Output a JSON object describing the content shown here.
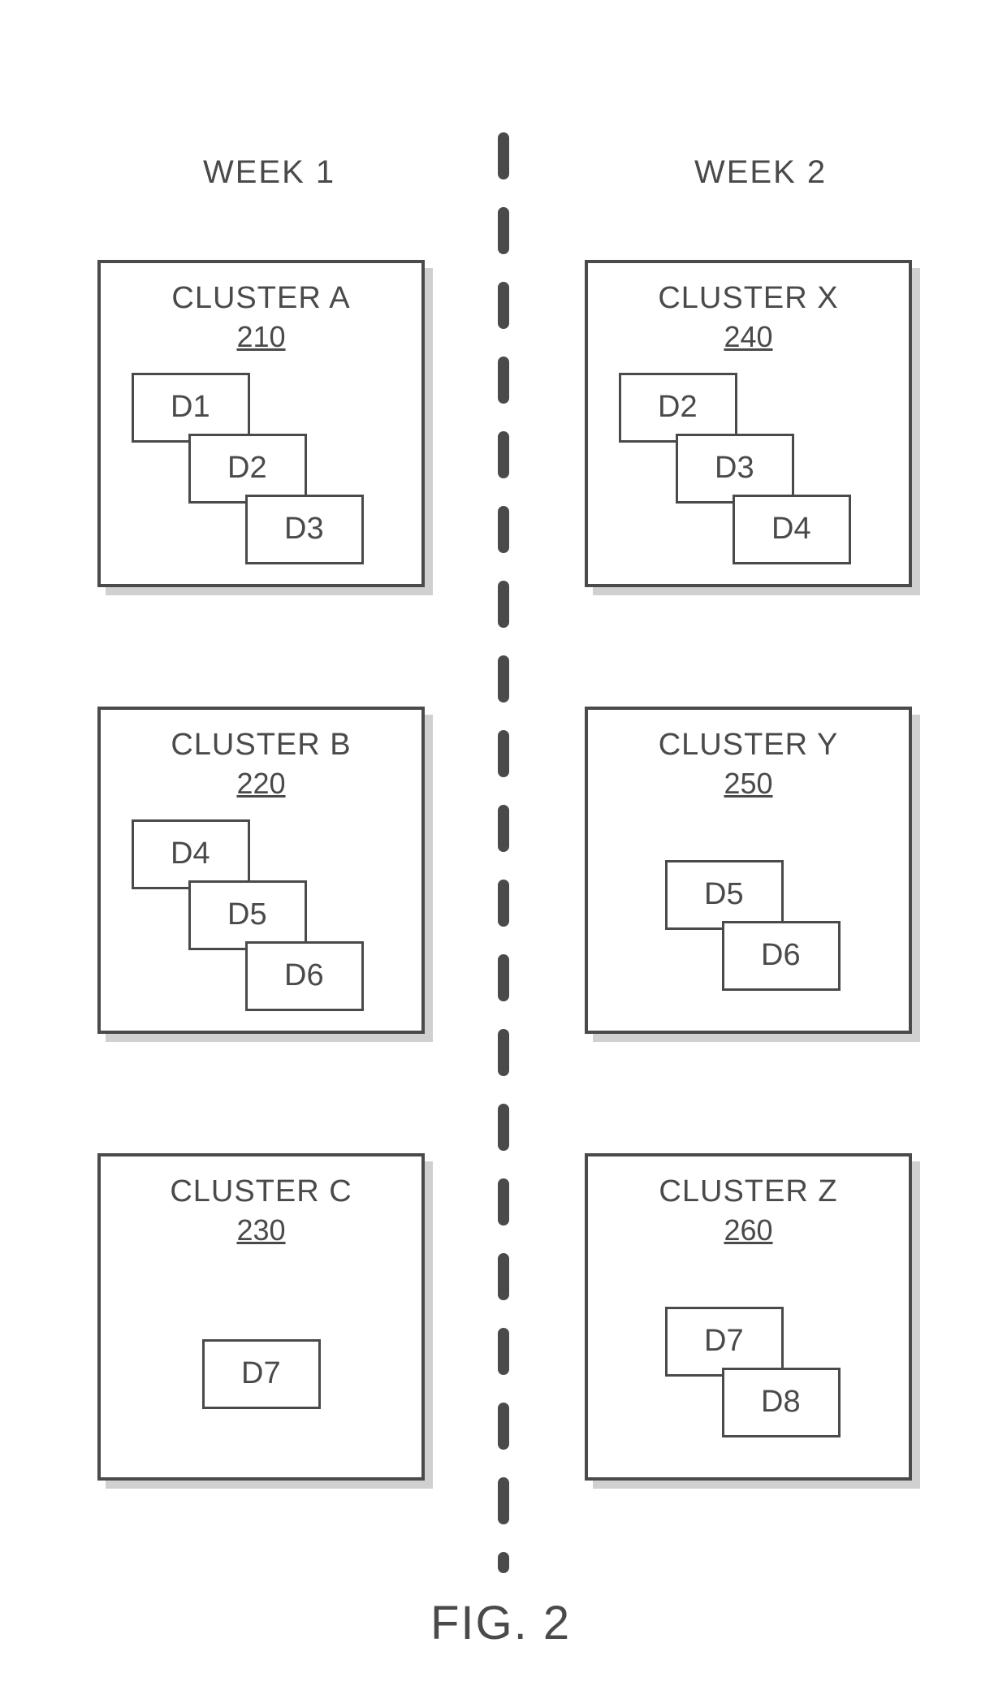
{
  "headers": {
    "left": "WEEK 1",
    "right": "WEEK 2"
  },
  "figure_label": "FIG. 2",
  "clusters": {
    "a": {
      "title": "CLUSTER A",
      "id": "210",
      "docs": [
        "D1",
        "D2",
        "D3"
      ]
    },
    "b": {
      "title": "CLUSTER B",
      "id": "220",
      "docs": [
        "D4",
        "D5",
        "D6"
      ]
    },
    "c": {
      "title": "CLUSTER C",
      "id": "230",
      "docs": [
        "D7"
      ]
    },
    "x": {
      "title": "CLUSTER X",
      "id": "240",
      "docs": [
        "D2",
        "D3",
        "D4"
      ]
    },
    "y": {
      "title": "CLUSTER Y",
      "id": "250",
      "docs": [
        "D5",
        "D6"
      ]
    },
    "z": {
      "title": "CLUSTER Z",
      "id": "260",
      "docs": [
        "D7",
        "D8"
      ]
    }
  }
}
